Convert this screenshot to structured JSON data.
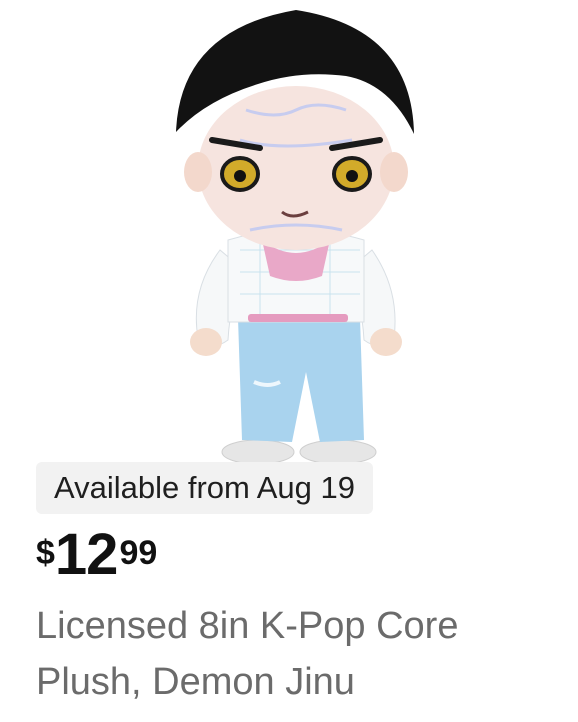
{
  "product": {
    "image_alt": "K-Pop Core Plush Demon Jinu",
    "availability": "Available from Aug 19",
    "price": {
      "currency": "$",
      "whole": "12",
      "cents": "99"
    },
    "title": "Licensed 8in K-Pop Core Plush, Demon Jinu"
  }
}
